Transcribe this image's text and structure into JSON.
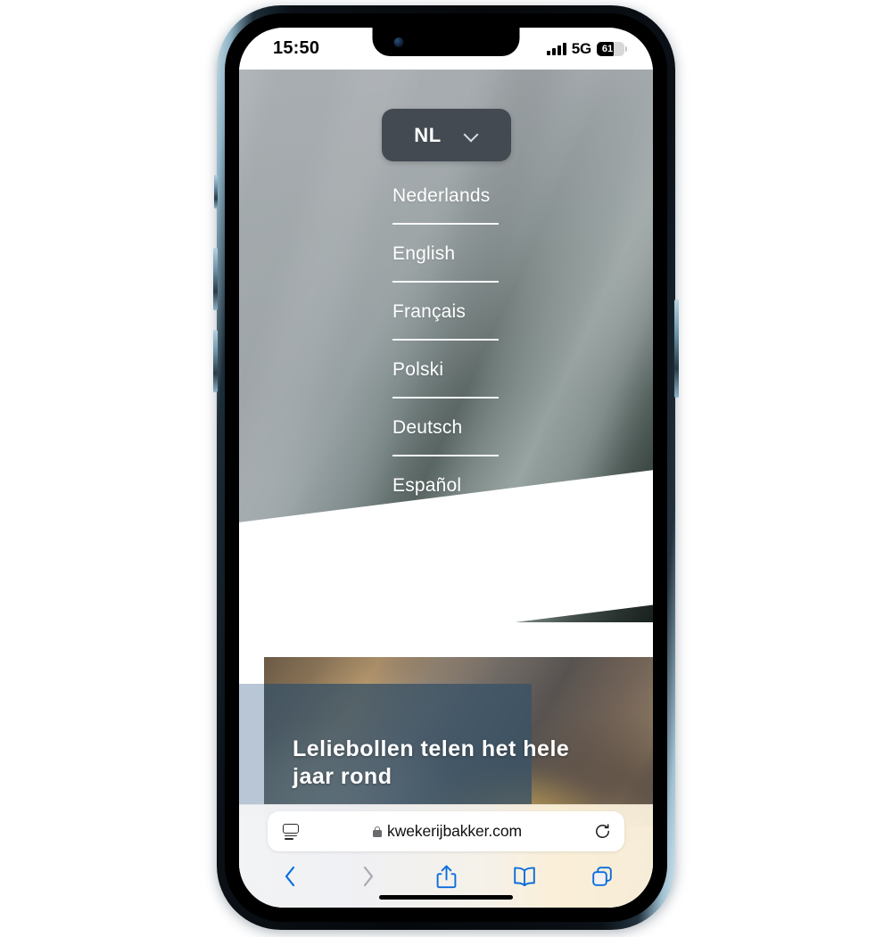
{
  "device": {
    "name": "iphone-13",
    "frame_color": "#0a1016",
    "edge_color": "#9fc0d2"
  },
  "status_bar": {
    "time": "15:50",
    "network": "5G",
    "signal_bars": 4,
    "battery_percent": "61",
    "battery_level": 61
  },
  "page": {
    "url": "kwekerijbakker.com",
    "secure": true,
    "language_selector": {
      "current_code": "NL",
      "chevron": "chevron-down-icon",
      "open": true,
      "options": [
        {
          "label": "Nederlands",
          "code": "NL"
        },
        {
          "label": "English",
          "code": "EN"
        },
        {
          "label": "Français",
          "code": "FR"
        },
        {
          "label": "Polski",
          "code": "PL"
        },
        {
          "label": "Deutsch",
          "code": "DE"
        },
        {
          "label": "Español",
          "code": "ES"
        }
      ]
    },
    "article_card": {
      "title": "Leliebollen telen het hele jaar rond",
      "overlay_color": "#3a5266"
    }
  },
  "browser_chrome": {
    "reader_icon": "reader-view-icon",
    "lock_icon": "lock-icon",
    "reload_icon": "reload-icon",
    "toolbar": [
      {
        "name": "back-button",
        "icon": "chevron-left-icon",
        "enabled": true
      },
      {
        "name": "forward-button",
        "icon": "chevron-right-icon",
        "enabled": false
      },
      {
        "name": "share-button",
        "icon": "share-icon",
        "enabled": true
      },
      {
        "name": "bookmarks-button",
        "icon": "book-icon",
        "enabled": true
      },
      {
        "name": "tabs-button",
        "icon": "tabs-icon",
        "enabled": true
      }
    ],
    "accent_color": "#007AFF",
    "disabled_color": "#a8a8ad"
  }
}
